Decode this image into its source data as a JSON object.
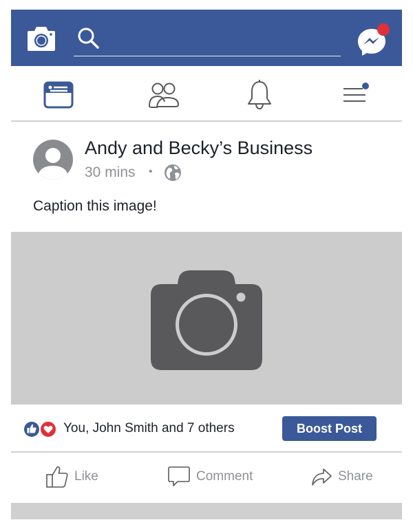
{
  "header": {
    "search_placeholder": "",
    "camera_icon": "camera-icon",
    "messenger_icon": "messenger-icon",
    "messenger_has_notification": true
  },
  "nav": {
    "items": [
      {
        "name": "news-feed",
        "icon": "newsfeed-icon",
        "active": true
      },
      {
        "name": "friends",
        "icon": "friends-icon",
        "active": false
      },
      {
        "name": "notifications",
        "icon": "bell-icon",
        "active": false
      },
      {
        "name": "menu",
        "icon": "menu-icon",
        "active": false,
        "has_dot": true
      }
    ]
  },
  "post": {
    "author": "Andy and Becky’s Business",
    "time": "30 mins",
    "separator": "•",
    "privacy_icon": "globe-icon",
    "caption": "Caption this image!",
    "image_placeholder_icon": "camera-icon",
    "reactions": {
      "icons": [
        "like-reaction-icon",
        "love-reaction-icon"
      ],
      "text": "You, John Smith and 7 others"
    },
    "boost_label": "Boost Post",
    "actions": {
      "like": "Like",
      "comment": "Comment",
      "share": "Share"
    }
  },
  "colors": {
    "brand": "#3b5998",
    "notification": "#e0303a",
    "love": "#e0303a",
    "image_bg": "#cccccc",
    "icon_gray": "#59595b"
  }
}
